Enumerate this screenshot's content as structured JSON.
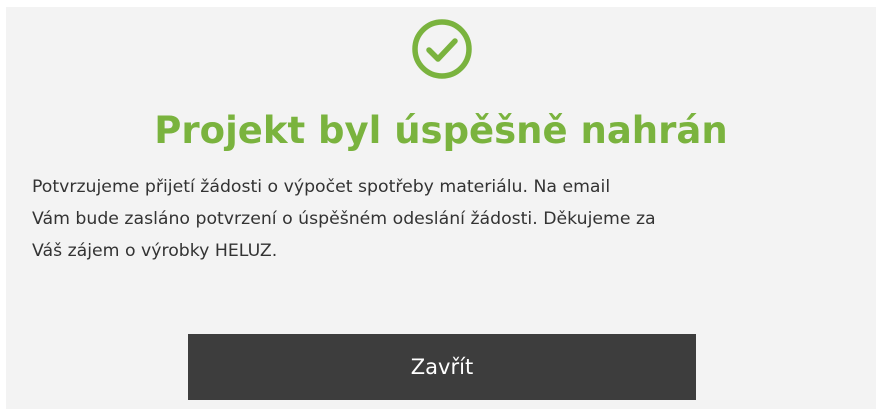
{
  "dialog": {
    "icon": "check-circle-icon",
    "title": "Projekt byl úspěšně nahrán",
    "message_lines": [
      "Potvrzujeme přijetí žádosti o výpočet spotřeby materiálu. Na email",
      "Vám bude zasláno potvrzení o úspěšném odeslání žádosti. Děkujeme za",
      "Váš zájem o výrobky HELUZ."
    ],
    "close_label": "Zavřít"
  },
  "colors": {
    "accent": "#7ab33e",
    "button_bg": "#3d3d3d",
    "dialog_bg": "#f3f3f3"
  }
}
